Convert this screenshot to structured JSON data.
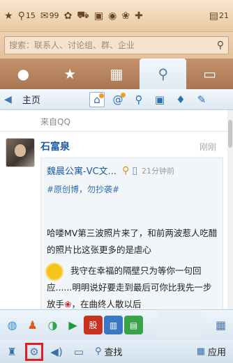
{
  "topbar": {
    "items": [
      {
        "icon": "star-pin-icon",
        "glyph": "★",
        "count": ""
      },
      {
        "icon": "qzone-icon",
        "glyph": "⚲",
        "count": "15"
      },
      {
        "icon": "mail-icon",
        "glyph": "✉",
        "count": "99"
      },
      {
        "icon": "clover-icon",
        "glyph": "✿",
        "count": ""
      },
      {
        "icon": "shop-cart-icon",
        "glyph": "⛟",
        "count": ""
      },
      {
        "icon": "wallet-icon",
        "glyph": "▣",
        "count": ""
      },
      {
        "icon": "game-icon",
        "glyph": "◉",
        "count": ""
      },
      {
        "icon": "pet-icon",
        "glyph": "❀",
        "count": ""
      },
      {
        "icon": "add-icon",
        "glyph": "✚",
        "count": ""
      }
    ],
    "msg_count": "21"
  },
  "search": {
    "placeholder": "搜索：联系人、讨论组、群、企业"
  },
  "tabs": [
    {
      "name": "contacts-tab",
      "glyph": "👤"
    },
    {
      "name": "favorites-tab",
      "glyph": "★"
    },
    {
      "name": "photos-tab",
      "glyph": "▦"
    },
    {
      "name": "weibo-tab",
      "glyph": "⚲"
    },
    {
      "name": "messages-tab",
      "glyph": "▤"
    }
  ],
  "subbar": {
    "home_label": "主页"
  },
  "feed": {
    "from": "来自QQ",
    "user_name": "石富泉",
    "post_time": "刚刚",
    "repost": {
      "author": "魏晨公寓-VC文...",
      "time": "21分钟前",
      "tag": "#原创博，勿抄袭#",
      "line1": "哈喽MV第三波照片来了，和前两波惹人吃醋的照片比这张更多的是虐心",
      "line2": "我守在幸福的隔壁只为等你一句回应......明明说好要走到最后可你比我先一步放手",
      "line3": "，在曲终人散以后"
    }
  },
  "bottom": {
    "find_label": "查找",
    "apps_label": "应用"
  },
  "colors": {
    "highlight": "#e0211b",
    "link": "#1c5aa0"
  }
}
